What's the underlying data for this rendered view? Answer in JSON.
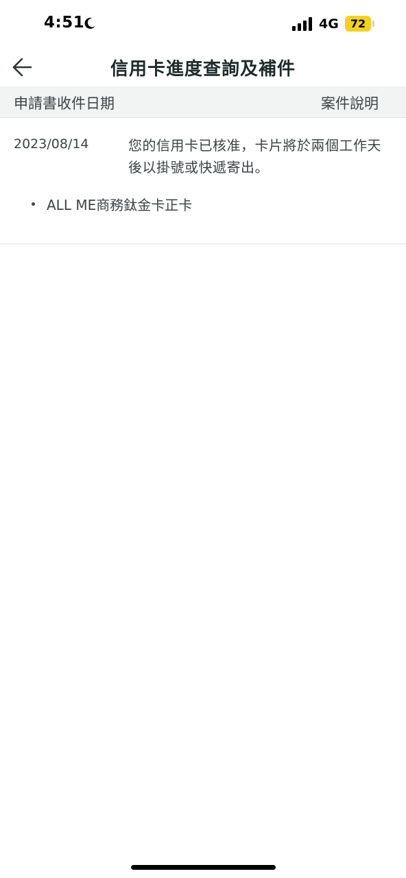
{
  "status_bar": {
    "time": "4:51",
    "network": "4G",
    "battery": "72",
    "icons": [
      "moon-icon",
      "signal-icon"
    ]
  },
  "header": {
    "title": "信用卡進度查詢及補件",
    "back_icon": "arrow-left-icon"
  },
  "table": {
    "columns": [
      "申請書收件日期",
      "案件說明"
    ],
    "rows": [
      {
        "date": "2023/08/14",
        "description": "您的信用卡已核准，卡片將於兩個工作天後以掛號或快遞寄出。",
        "cards": [
          "ALL ME商務鈦金卡正卡"
        ]
      }
    ]
  },
  "colors": {
    "battery": "#f4d21c",
    "table_header_bg": "#f2f3f3",
    "text": "#3a4446"
  }
}
